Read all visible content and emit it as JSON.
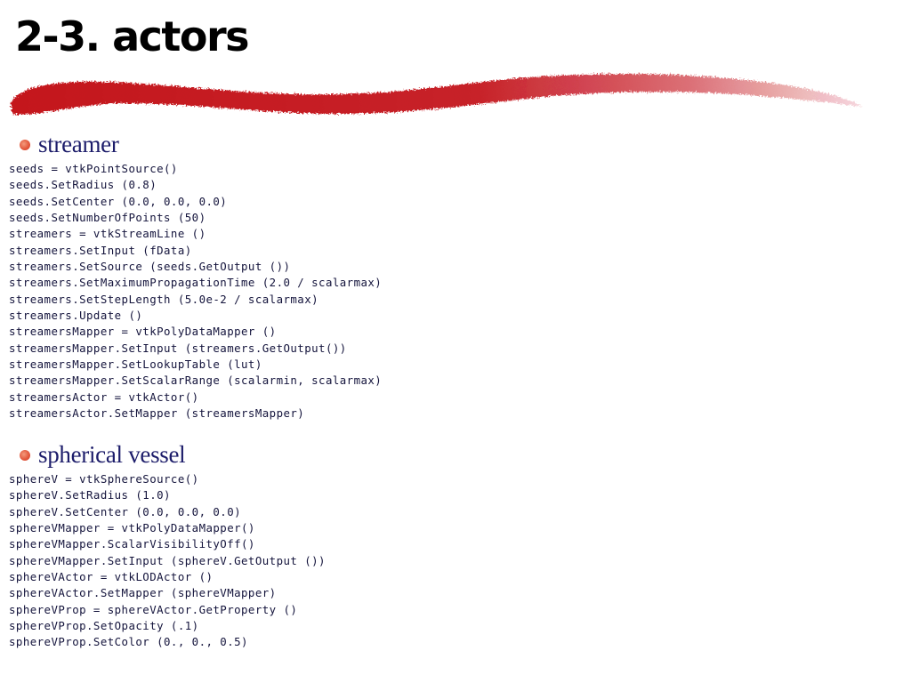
{
  "slide": {
    "title": "2-3. actors",
    "accent_color": "#c4141e"
  },
  "sections": [
    {
      "heading": "streamer",
      "code_lines": [
        "seeds = vtkPointSource()",
        "seeds.SetRadius (0.8)",
        "seeds.SetCenter (0.0, 0.0, 0.0)",
        "seeds.SetNumberOfPoints (50)",
        "streamers = vtkStreamLine ()",
        "streamers.SetInput (fData)",
        "streamers.SetSource (seeds.GetOutput ())",
        "streamers.SetMaximumPropagationTime (2.0 / scalarmax)",
        "streamers.SetStepLength (5.0e-2 / scalarmax)",
        "streamers.Update ()",
        "streamersMapper = vtkPolyDataMapper ()",
        "streamersMapper.SetInput (streamers.GetOutput())",
        "streamersMapper.SetLookupTable (lut)",
        "streamersMapper.SetScalarRange (scalarmin, scalarmax)",
        "streamersActor = vtkActor()",
        "streamersActor.SetMapper (streamersMapper)"
      ]
    },
    {
      "heading": "spherical vessel",
      "code_lines": [
        "sphereV = vtkSphereSource()",
        "sphereV.SetRadius (1.0)",
        "sphereV.SetCenter (0.0, 0.0, 0.0)",
        "sphereVMapper = vtkPolyDataMapper()",
        "sphereVMapper.ScalarVisibilityOff()",
        "sphereVMapper.SetInput (sphereV.GetOutput ())",
        "sphereVActor = vtkLODActor ()",
        "sphereVActor.SetMapper (sphereVMapper)",
        "sphereVProp = sphereVActor.GetProperty ()",
        "sphereVProp.SetOpacity (.1)",
        "sphereVProp.SetColor (0., 0., 0.5)"
      ]
    }
  ]
}
